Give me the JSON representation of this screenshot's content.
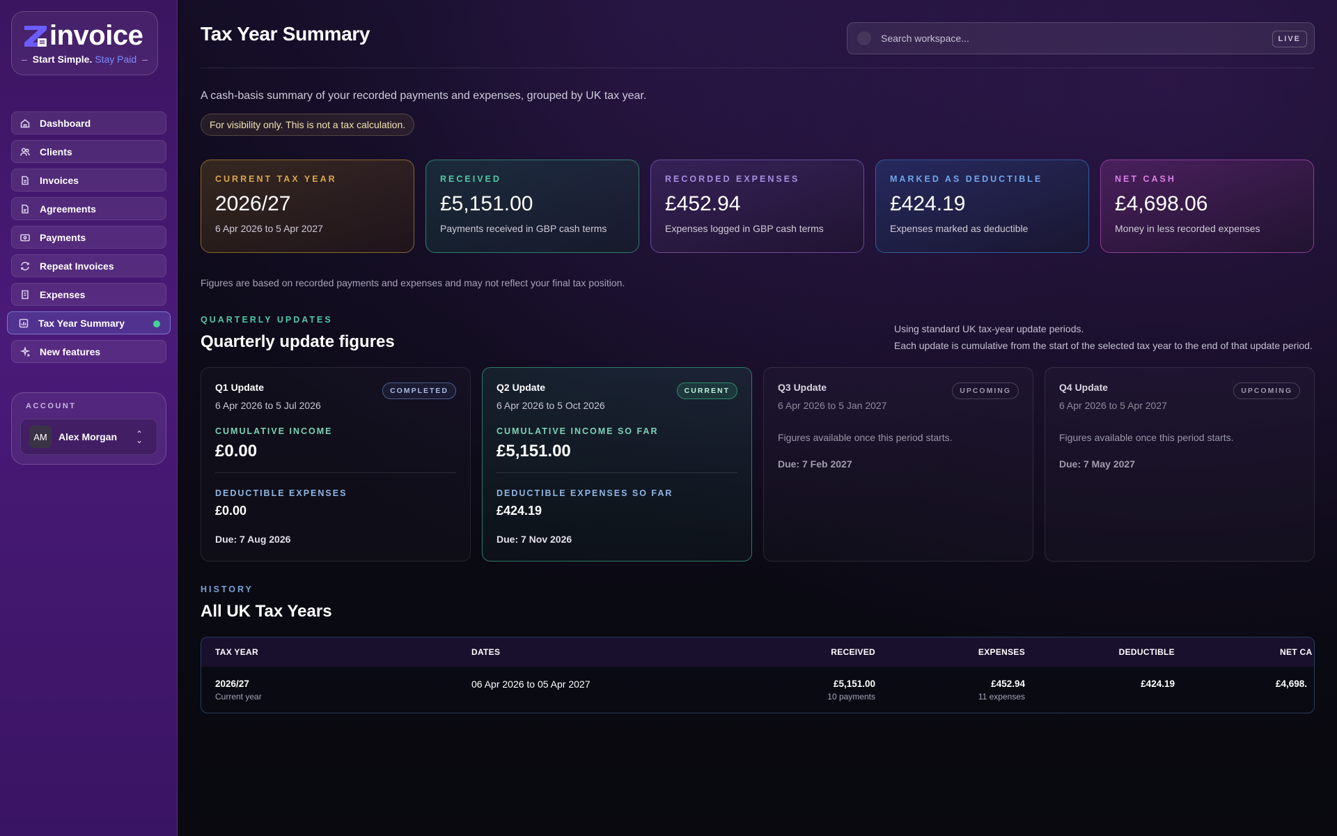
{
  "brand": {
    "name": "invoice",
    "tagline_strong": "Start Simple.",
    "tagline_accent": "Stay Paid",
    "dash": "–"
  },
  "sidebar": {
    "items": [
      {
        "label": "Dashboard",
        "icon": "home-icon"
      },
      {
        "label": "Clients",
        "icon": "users-icon"
      },
      {
        "label": "Invoices",
        "icon": "file-icon"
      },
      {
        "label": "Agreements",
        "icon": "document-icon"
      },
      {
        "label": "Payments",
        "icon": "card-icon"
      },
      {
        "label": "Repeat Invoices",
        "icon": "repeat-icon"
      },
      {
        "label": "Expenses",
        "icon": "receipt-icon"
      },
      {
        "label": "Tax Year Summary",
        "icon": "chart-icon",
        "active": true
      },
      {
        "label": "New features",
        "icon": "sparkle-icon"
      }
    ],
    "active_dot_color": "#43d39a"
  },
  "account": {
    "label": "ACCOUNT",
    "initials": "AM",
    "name": "Alex Morgan"
  },
  "header": {
    "title": "Tax Year Summary",
    "search_placeholder": "Search workspace...",
    "live_badge": "LIVE"
  },
  "intro": "A cash-basis summary of your recorded payments and expenses, grouped by UK tax year.",
  "notice": "For visibility only. This is not a tax calculation.",
  "stats": [
    {
      "label": "CURRENT TAX YEAR",
      "value": "2026/27",
      "sub": "6 Apr 2026 to 5 Apr 2027",
      "color": "#d9a64a"
    },
    {
      "label": "RECEIVED",
      "value": "£5,151.00",
      "sub": "Payments received in GBP cash terms",
      "color": "#53c7a4"
    },
    {
      "label": "RECORDED EXPENSES",
      "value": "£452.94",
      "sub": "Expenses logged in GBP cash terms",
      "color": "#a98ee0"
    },
    {
      "label": "MARKED AS DEDUCTIBLE",
      "value": "£424.19",
      "sub": "Expenses marked as deductible",
      "color": "#6fa6ec"
    },
    {
      "label": "NET CASH",
      "value": "£4,698.06",
      "sub": "Money in less recorded expenses",
      "color": "#dc7ee3"
    }
  ],
  "disclaimer": "Figures are based on recorded payments and expenses and may not reflect your final tax position.",
  "quarterly": {
    "eyebrow": "QUARTERLY UPDATES",
    "title": "Quarterly update figures",
    "note_line1": "Using standard UK tax-year update periods.",
    "note_line2": "Each update is cumulative from the start of the selected tax year to the end of that update period.",
    "q1": {
      "name": "Q1 Update",
      "dates": "6 Apr 2026 to 5 Jul 2026",
      "badge": "COMPLETED",
      "income_label": "CUMULATIVE INCOME",
      "income": "£0.00",
      "deduct_label": "DEDUCTIBLE EXPENSES",
      "deduct": "£0.00",
      "due": "Due: 7 Aug 2026"
    },
    "q2": {
      "name": "Q2 Update",
      "dates": "6 Apr 2026 to 5 Oct 2026",
      "badge": "CURRENT",
      "income_label": "CUMULATIVE INCOME SO FAR",
      "income": "£5,151.00",
      "deduct_label": "DEDUCTIBLE EXPENSES SO FAR",
      "deduct": "£424.19",
      "due": "Due: 7 Nov 2026"
    },
    "q3": {
      "name": "Q3 Update",
      "dates": "6 Apr 2026 to 5 Jan 2027",
      "badge": "UPCOMING",
      "avail": "Figures available once this period starts.",
      "due": "Due: 7 Feb 2027"
    },
    "q4": {
      "name": "Q4 Update",
      "dates": "6 Apr 2026 to 5 Apr 2027",
      "badge": "UPCOMING",
      "avail": "Figures available once this period starts.",
      "due": "Due: 7 May 2027"
    }
  },
  "history": {
    "eyebrow": "HISTORY",
    "title": "All UK Tax Years",
    "columns": {
      "tax_year": "TAX YEAR",
      "dates": "DATES",
      "received": "RECEIVED",
      "expenses": "EXPENSES",
      "deductible": "DEDUCTIBLE",
      "net_cash": "NET CA"
    },
    "rows": [
      {
        "tax_year": "2026/27",
        "tax_year_sub": "Current year",
        "dates": "06 Apr 2026 to 05 Apr 2027",
        "received": "£5,151.00",
        "received_sub": "10 payments",
        "expenses": "£452.94",
        "expenses_sub": "11 expenses",
        "deductible": "£424.19",
        "net_cash": "£4,698."
      }
    ]
  }
}
